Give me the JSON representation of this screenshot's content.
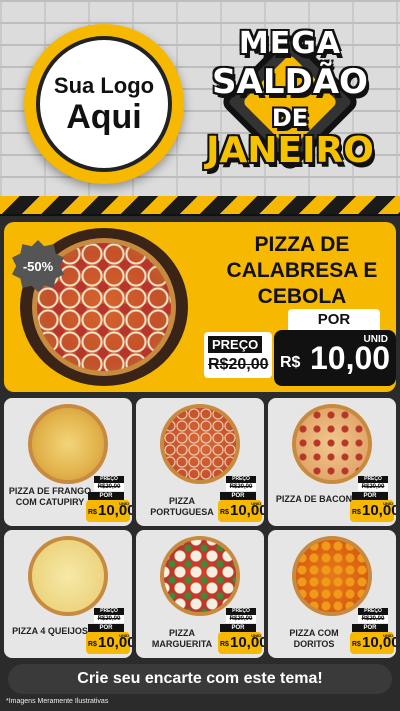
{
  "logo": {
    "line1": "Sua Logo",
    "line2": "Aqui"
  },
  "badge": {
    "line1": "MEGA",
    "line2": "SALDÃO",
    "line3": "DE",
    "line4": "JANEIRO"
  },
  "featured": {
    "discount": "-50%",
    "title": "PIZZA DE CALABRESA E CEBOLA",
    "por_label": "POR",
    "preco_label": "PREÇO",
    "old_price": "R$20,00",
    "unit": "UNID",
    "currency": "R$",
    "price": "10,00"
  },
  "products": [
    {
      "name": "PIZZA DE FRANGO COM CATUPIRY",
      "preco_label": "PREÇO",
      "old_price": "R$20,00",
      "por_label": "POR",
      "currency": "R$",
      "price": "10,00",
      "unit": "UNID"
    },
    {
      "name": "PIZZA PORTUGUESA",
      "preco_label": "PREÇO",
      "old_price": "R$20,00",
      "por_label": "POR",
      "currency": "R$",
      "price": "10,00",
      "unit": "UNID"
    },
    {
      "name": "PIZZA DE BACON",
      "preco_label": "PREÇO",
      "old_price": "R$20,00",
      "por_label": "POR",
      "currency": "R$",
      "price": "10,00",
      "unit": "UNID"
    },
    {
      "name": "PIZZA 4 QUEIJOS",
      "preco_label": "PREÇO",
      "old_price": "R$20,00",
      "por_label": "POR",
      "currency": "R$",
      "price": "10,00",
      "unit": "UNID"
    },
    {
      "name": "PIZZA MARGUERITA",
      "preco_label": "PREÇO",
      "old_price": "R$20,00",
      "por_label": "POR",
      "currency": "R$",
      "price": "10,00",
      "unit": "UNID"
    },
    {
      "name": "PIZZA COM DORITOS",
      "preco_label": "PREÇO",
      "old_price": "R$20,00",
      "por_label": "POR",
      "currency": "R$",
      "price": "10,00",
      "unit": "UNID"
    }
  ],
  "cta": "Crie seu encarte com este tema!",
  "note": "*Imagens Meramente Ilustrativas",
  "colors": {
    "accent": "#f6b800",
    "dark": "#111111",
    "card": "#e6e6e6"
  }
}
